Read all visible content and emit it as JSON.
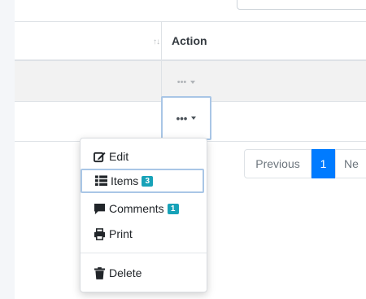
{
  "table": {
    "header": {
      "action_label": "Action",
      "sort_icon": "sort-icon"
    },
    "rows": [
      {
        "action_icon": "ellipsis-icon"
      },
      {
        "action_icon": "ellipsis-icon"
      }
    ],
    "ellipsis": "•••"
  },
  "pagination": {
    "previous_label": "Previous",
    "current_page": "1",
    "next_label": "Ne"
  },
  "action_menu": {
    "items": [
      {
        "label": "Edit",
        "icon": "edit-icon"
      },
      {
        "label": "Items",
        "icon": "list-icon",
        "badge": "3"
      },
      {
        "label": "Comments",
        "icon": "comment-icon",
        "badge": "1"
      },
      {
        "label": "Print",
        "icon": "print-icon"
      },
      {
        "label": "Delete",
        "icon": "trash-icon"
      }
    ]
  },
  "colors": {
    "primary": "#007bff",
    "badge": "#17a2b8",
    "focus_ring": "#a9c6e6"
  }
}
